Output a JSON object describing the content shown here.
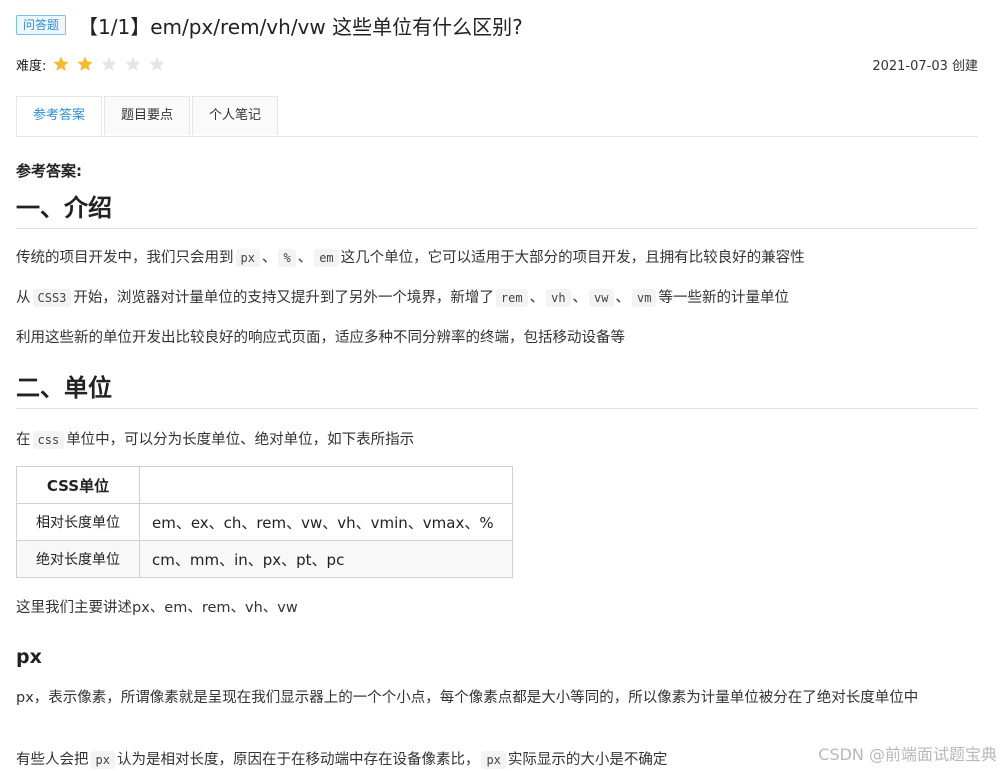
{
  "header": {
    "tag": "问答题",
    "title": "【1/1】em/px/rem/vh/vw 这些单位有什么区别?",
    "difficulty_label": "难度:",
    "rating": 2,
    "rating_max": 5,
    "created": "2021-07-03 创建"
  },
  "tabs": [
    {
      "label": "参考答案",
      "active": true
    },
    {
      "label": "题目要点",
      "active": false
    },
    {
      "label": "个人笔记",
      "active": false
    }
  ],
  "content": {
    "answer_label": "参考答案:",
    "section1_title": "一、介绍",
    "p1": {
      "t1": "传统的项目开发中，我们只会用到",
      "c1": "px",
      "s1": "、",
      "c2": "%",
      "s2": "、",
      "c3": "em",
      "t2": "这几个单位，它可以适用于大部分的项目开发，且拥有比较良好的兼容性"
    },
    "p2": {
      "t1": "从",
      "c1": "CSS3",
      "t2": "开始，浏览器对计量单位的支持又提升到了另外一个境界，新增了",
      "c2": "rem",
      "s1": "、",
      "c3": "vh",
      "s2": "、",
      "c4": "vw",
      "s3": "、",
      "c5": "vm",
      "t3": "等一些新的计量单位"
    },
    "p3": "利用这些新的单位开发出比较良好的响应式页面，适应多种不同分辨率的终端，包括移动设备等",
    "section2_title": "二、单位",
    "p4": {
      "t1": "在",
      "c1": "css",
      "t2": "单位中，可以分为长度单位、绝对单位，如下表所指示"
    },
    "table": {
      "header": "CSS单位",
      "rows": [
        {
          "name": "相对长度单位",
          "value": "em、ex、ch、rem、vw、vh、vmin、vmax、%"
        },
        {
          "name": "绝对长度单位",
          "value": "cm、mm、in、px、pt、pc"
        }
      ]
    },
    "p5": "这里我们主要讲述px、em、rem、vh、vw",
    "h3": "px",
    "p6": "px，表示像素，所谓像素就是呈现在我们显示器上的一个个小点，每个像素点都是大小等同的，所以像素为计量单位被分在了绝对长度单位中",
    "p7": {
      "t1": "有些人会把",
      "c1": "px",
      "t2": "认为是相对长度，原因在于在移动端中存在设备像素比，",
      "c2": "px",
      "t3": "实际显示的大小是不确定"
    }
  },
  "watermark": "CSDN @前端面试题宝典",
  "colors": {
    "accent": "#2b8fd6",
    "star_on": "#f7ba2a",
    "star_off": "#e6e6e6"
  }
}
